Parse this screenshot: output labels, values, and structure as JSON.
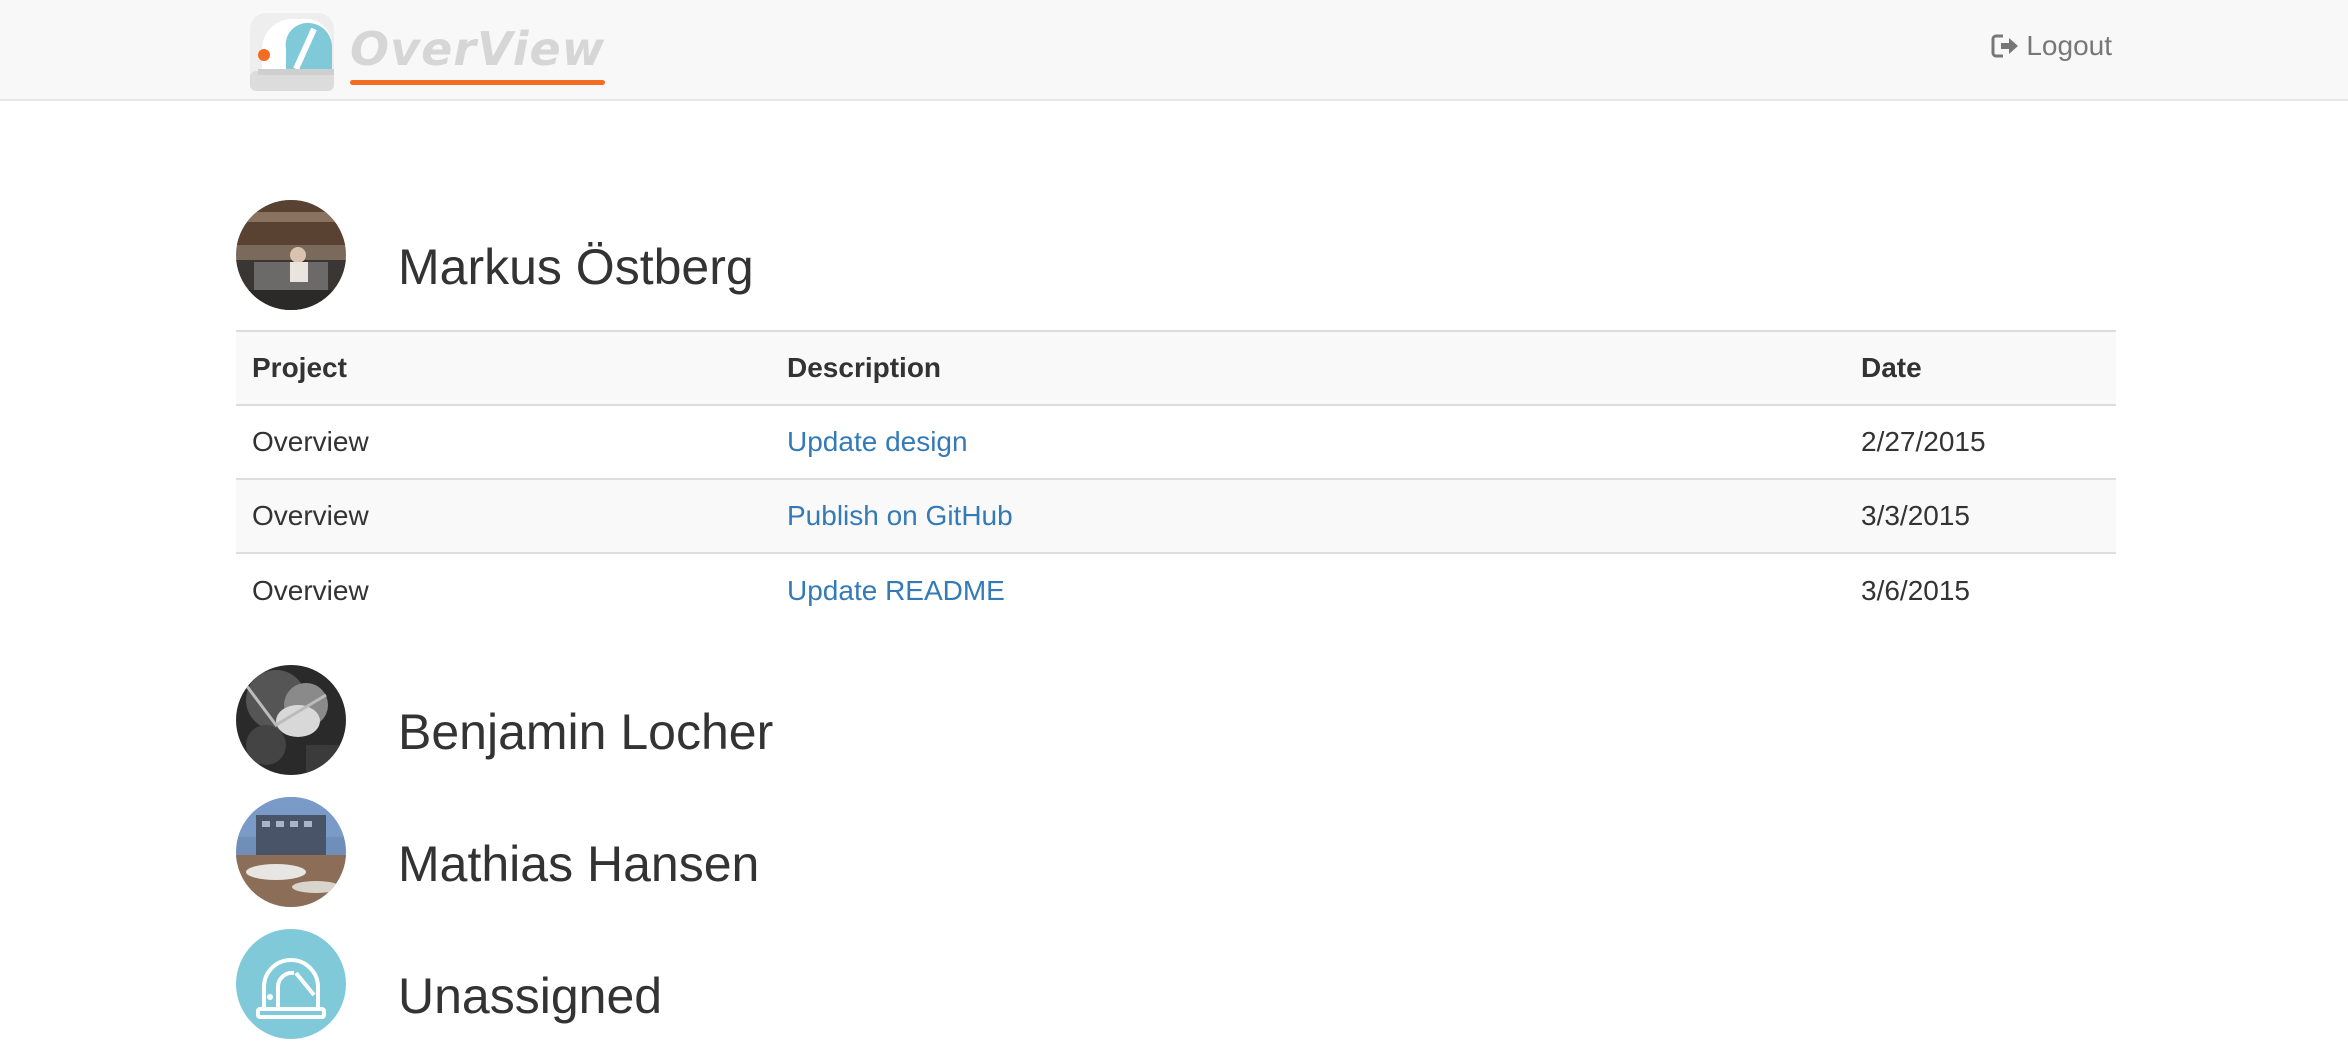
{
  "navbar": {
    "brand": "OverView",
    "logout_label": "Logout"
  },
  "colors": {
    "brand_accent": "#f26d21",
    "link": "#337ab7",
    "logo_blue": "#7fc9d9"
  },
  "table_headers": {
    "project": "Project",
    "description": "Description",
    "date": "Date"
  },
  "people": [
    {
      "name": "Markus Östberg",
      "avatar": "photo-avatar",
      "tasks": [
        {
          "project": "Overview",
          "description": "Update design",
          "date": "2/27/2015"
        },
        {
          "project": "Overview",
          "description": "Publish on GitHub",
          "date": "3/3/2015"
        },
        {
          "project": "Overview",
          "description": "Update README",
          "date": "3/6/2015"
        }
      ]
    },
    {
      "name": "Benjamin Locher",
      "avatar": "photo-avatar"
    },
    {
      "name": "Mathias Hansen",
      "avatar": "photo-avatar"
    },
    {
      "name": "Unassigned",
      "avatar": "observatory-logo-avatar"
    }
  ]
}
